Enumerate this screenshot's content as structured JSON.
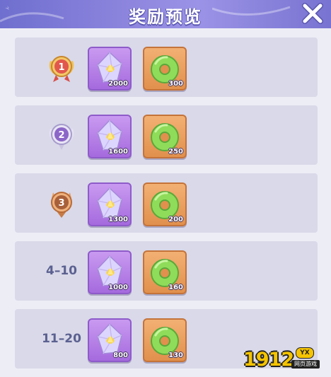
{
  "header": {
    "title": "奖励预览",
    "close_icon": "close-x-icon",
    "accent_color": "#8e86de"
  },
  "rows": [
    {
      "rank_type": "gold-badge",
      "rank_label": "1",
      "rewards": [
        {
          "icon": "crystal-gem-icon",
          "qty": "2000"
        },
        {
          "icon": "jade-ring-icon",
          "qty": "300"
        }
      ]
    },
    {
      "rank_type": "silver-badge",
      "rank_label": "2",
      "rewards": [
        {
          "icon": "crystal-gem-icon",
          "qty": "1600"
        },
        {
          "icon": "jade-ring-icon",
          "qty": "250"
        }
      ]
    },
    {
      "rank_type": "bronze-badge",
      "rank_label": "3",
      "rewards": [
        {
          "icon": "crystal-gem-icon",
          "qty": "1300"
        },
        {
          "icon": "jade-ring-icon",
          "qty": "200"
        }
      ]
    },
    {
      "rank_type": "text",
      "rank_label": "4–10",
      "rewards": [
        {
          "icon": "crystal-gem-icon",
          "qty": "1000"
        },
        {
          "icon": "jade-ring-icon",
          "qty": "160"
        }
      ]
    },
    {
      "rank_type": "text",
      "rank_label": "11–20",
      "rewards": [
        {
          "icon": "crystal-gem-icon",
          "qty": "800"
        },
        {
          "icon": "jade-ring-icon",
          "qty": "130"
        }
      ]
    }
  ],
  "watermark": {
    "number": "1912",
    "badge": "YX",
    "sub": "网页游戏"
  }
}
